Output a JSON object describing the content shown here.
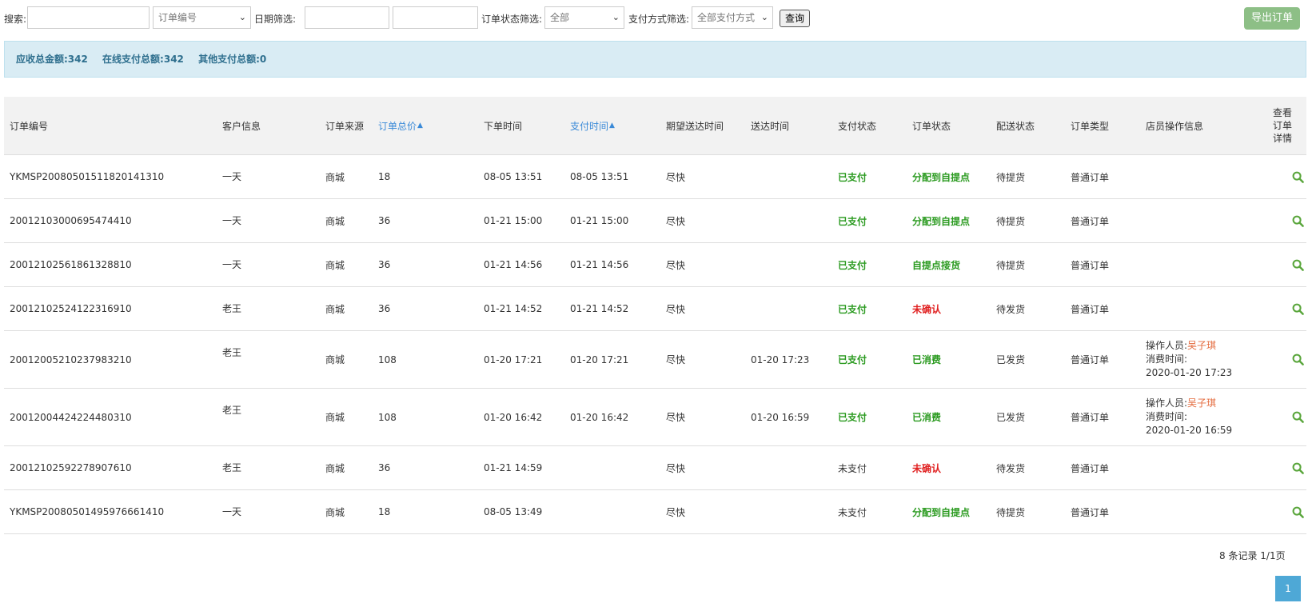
{
  "toolbar": {
    "search_label": "搜索:",
    "search_value": "",
    "search_type": "订单编号",
    "date_label": "日期筛选:",
    "date_start": "",
    "date_end": "",
    "status_label": "订单状态筛选:",
    "status_value": "全部",
    "pay_label": "支付方式筛选:",
    "pay_value": "全部支付方式",
    "query_label": "查询",
    "export_label": "导出订单"
  },
  "summary": {
    "receivable": "应收总金额:342",
    "online": "在线支付总额:342",
    "other": "其他支付总额:0"
  },
  "table": {
    "headers": {
      "order_no": "订单编号",
      "customer": "客户信息",
      "source": "订单来源",
      "total": "订单总价",
      "created": "下单时间",
      "paid_at": "支付时间",
      "expected": "期望送达时间",
      "delivered": "送达时间",
      "pay_status": "支付状态",
      "order_status": "订单状态",
      "delivery_status": "配送状态",
      "order_type": "订单类型",
      "staff": "店员操作信息",
      "view": "查看订单详情"
    },
    "rows": [
      {
        "order_no": "YKMSP20080501511820141310",
        "customer": "一天",
        "source": "商城",
        "total": "18",
        "created": "08-05 13:51",
        "paid_at": "08-05 13:51",
        "expected": "尽快",
        "delivered": "",
        "pay_status": "已支付",
        "order_status": "分配到自提点",
        "delivery_status": "待提货",
        "order_type": "普通订单"
      },
      {
        "order_no": "20012103000695474410",
        "customer": "一天",
        "source": "商城",
        "total": "36",
        "created": "01-21 15:00",
        "paid_at": "01-21 15:00",
        "expected": "尽快",
        "delivered": "",
        "pay_status": "已支付",
        "order_status": "分配到自提点",
        "delivery_status": "待提货",
        "order_type": "普通订单"
      },
      {
        "order_no": "20012102561861328810",
        "customer": "一天",
        "source": "商城",
        "total": "36",
        "created": "01-21 14:56",
        "paid_at": "01-21 14:56",
        "expected": "尽快",
        "delivered": "",
        "pay_status": "已支付",
        "order_status": "自提点接货",
        "delivery_status": "待提货",
        "order_type": "普通订单"
      },
      {
        "order_no": "20012102524122316910",
        "customer": "老王",
        "source": "商城",
        "total": "36",
        "created": "01-21 14:52",
        "paid_at": "01-21 14:52",
        "expected": "尽快",
        "delivered": "",
        "pay_status": "已支付",
        "order_status": "未确认",
        "delivery_status": "待发货",
        "order_type": "普通订单"
      },
      {
        "order_no": "20012005210237983210",
        "customer": "老王",
        "source": "商城",
        "total": "108",
        "created": "01-20 17:21",
        "paid_at": "01-20 17:21",
        "expected": "尽快",
        "delivered": "01-20 17:23",
        "pay_status": "已支付",
        "order_status": "已消费",
        "delivery_status": "已发货",
        "order_type": "普通订单",
        "staff_label": "操作人员:",
        "staff_name": "吴子琪",
        "consume_label": "消费时间:",
        "consume_time": "2020-01-20 17:23"
      },
      {
        "order_no": "20012004424224480310",
        "customer": "老王",
        "source": "商城",
        "total": "108",
        "created": "01-20 16:42",
        "paid_at": "01-20 16:42",
        "expected": "尽快",
        "delivered": "01-20 16:59",
        "pay_status": "已支付",
        "order_status": "已消费",
        "delivery_status": "已发货",
        "order_type": "普通订单",
        "staff_label": "操作人员:",
        "staff_name": "吴子琪",
        "consume_label": "消费时间:",
        "consume_time": "2020-01-20 16:59"
      },
      {
        "order_no": "20012102592278907610",
        "customer": "老王",
        "source": "商城",
        "total": "36",
        "created": "01-21 14:59",
        "paid_at": "",
        "expected": "尽快",
        "delivered": "",
        "pay_status": "未支付",
        "order_status": "未确认",
        "delivery_status": "待发货",
        "order_type": "普通订单"
      },
      {
        "order_no": "YKMSP20080501495976661410",
        "customer": "一天",
        "source": "商城",
        "total": "18",
        "created": "08-05 13:49",
        "paid_at": "",
        "expected": "尽快",
        "delivered": "",
        "pay_status": "未支付",
        "order_status": "分配到自提点",
        "delivery_status": "待提货",
        "order_type": "普通订单"
      }
    ]
  },
  "pagination": {
    "info": "8 条记录 1/1页",
    "current_page": "1"
  },
  "colors": {
    "green": "#2a9a1f",
    "red": "#e02020",
    "link_blue": "#3a8ad8",
    "staff_name": "#e46a3c",
    "export_button": "#8dbf86",
    "summary_bg": "#d9ecf4",
    "page_button": "#4ea8d6"
  },
  "icons": {
    "view": "search-icon",
    "sort": "sort-icon"
  }
}
